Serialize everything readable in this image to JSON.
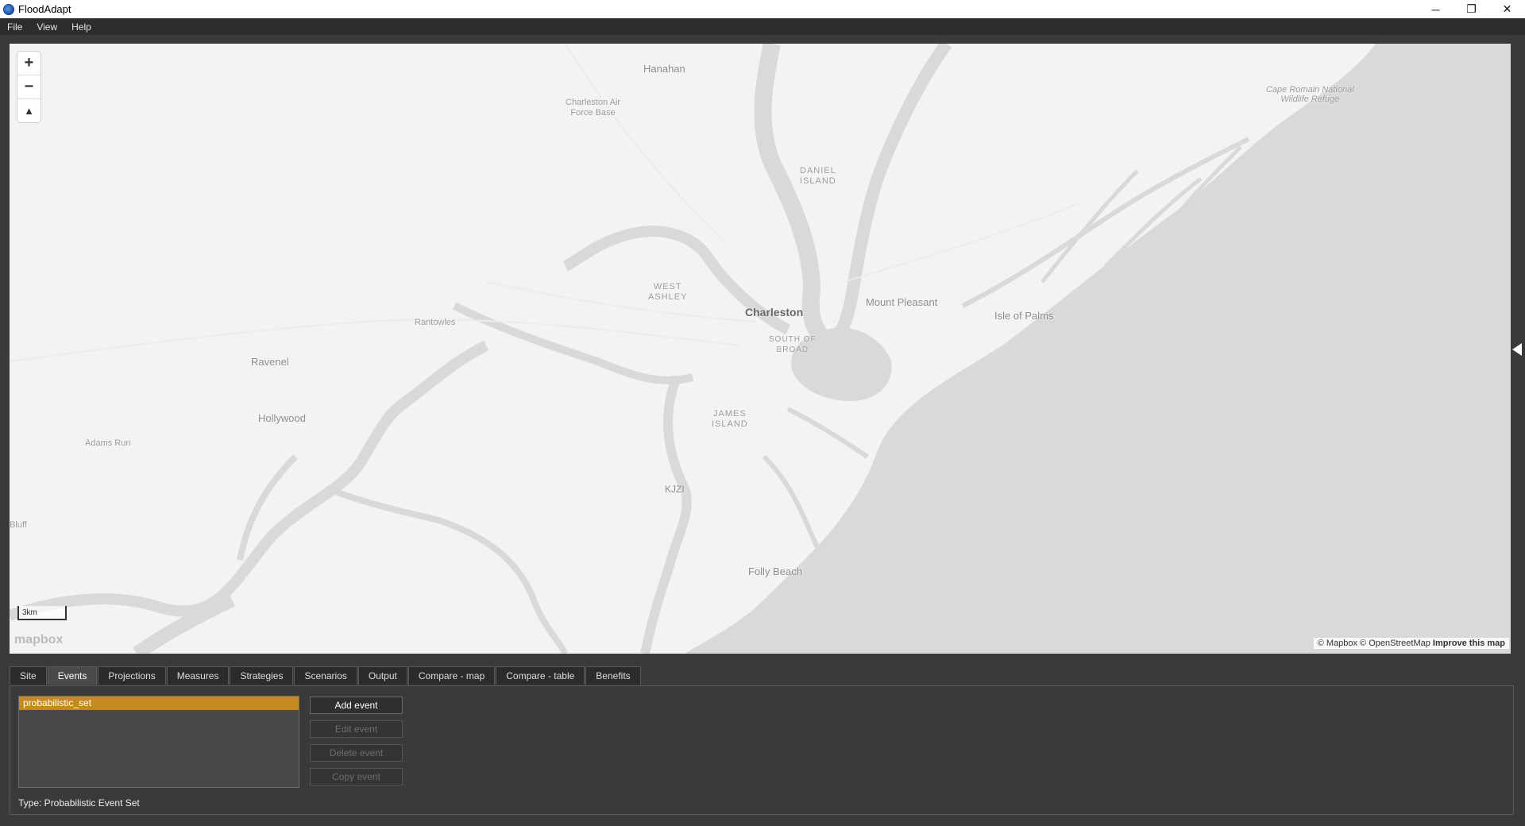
{
  "window": {
    "title": "FloodAdapt",
    "controls": [
      "─",
      "❐",
      "✕"
    ]
  },
  "menu": [
    "File",
    "View",
    "Help"
  ],
  "map": {
    "zoom_in": "+",
    "zoom_out": "−",
    "compass": "▲",
    "scale_label": "3km",
    "logo": "mapbox",
    "attribution": "© Mapbox © OpenStreetMap",
    "improve": "Improve this map",
    "labels": {
      "hanahan": "Hanahan",
      "airbase": "Charleston Air\nForce Base",
      "daniel_island": "DANIEL\nISLAND",
      "cape_romain": "Cape Romain National\nWildlife Refuge",
      "west_ashley": "WEST\nASHLEY",
      "charleston": "Charleston",
      "mount_pleasant": "Mount Pleasant",
      "isle_of_palms": "Isle of Palms",
      "south_of_broad": "SOUTH OF\nBROAD",
      "rantowles": "Rantowles",
      "ravenel": "Ravenel",
      "hollywood": "Hollywood",
      "adams_run": "Adams Run",
      "james_island": "JAMES\nISLAND",
      "kjzi": "KJZI",
      "bluff": "Bluff",
      "folly_beach": "Folly Beach"
    }
  },
  "tabs": [
    "Site",
    "Events",
    "Projections",
    "Measures",
    "Strategies",
    "Scenarios",
    "Output",
    "Compare - map",
    "Compare - table",
    "Benefits"
  ],
  "active_tab": "Events",
  "events": {
    "items": [
      "probabilistic_set"
    ],
    "buttons": {
      "add": "Add event",
      "edit": "Edit event",
      "delete": "Delete event",
      "copy": "Copy event"
    },
    "type_text": "Type: Probabilistic Event Set"
  },
  "colors": {
    "selected": "#c38a1e",
    "water": "#d9d9d9",
    "land": "#f3f3f3"
  }
}
